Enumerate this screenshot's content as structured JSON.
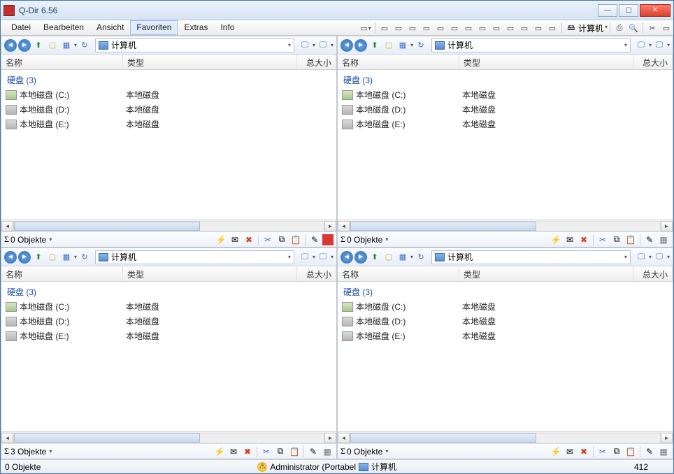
{
  "window": {
    "title": "Q-Dir 6.56"
  },
  "menu": {
    "file": "Datei",
    "edit": "Bearbeiten",
    "view": "Ansicht",
    "favorites": "Favoriten",
    "extras": "Extras",
    "info": "Info",
    "computer_label": "计算机"
  },
  "columns": {
    "name": "名称",
    "type": "类型",
    "size": "总大小"
  },
  "group": {
    "label": "硬盘 (3)"
  },
  "drives": [
    {
      "name": "本地磁盘 (C:)",
      "type": "本地磁盘",
      "kind": "c"
    },
    {
      "name": "本地磁盘 (D:)",
      "type": "本地磁盘",
      "kind": "d"
    },
    {
      "name": "本地磁盘 (E:)",
      "type": "本地磁盘",
      "kind": "d"
    }
  ],
  "address": {
    "label": "计算机"
  },
  "pane_status": {
    "p1": "0 Objekte",
    "p2": "0 Objekte",
    "p3": "3 Objekte",
    "p4": "0 Objekte"
  },
  "status": {
    "left": "0 Objekte",
    "user": "Administrator (Portabel",
    "location": "计算机",
    "number": "412"
  }
}
